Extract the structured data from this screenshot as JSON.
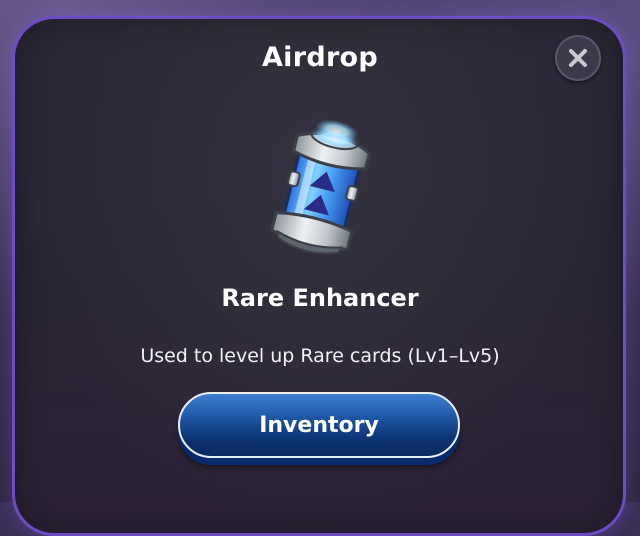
{
  "modal": {
    "title": "Airdrop",
    "close_icon": "close-icon"
  },
  "item": {
    "icon": "rare-enhancer-canister-icon",
    "name": "Rare Enhancer",
    "description": "Used to level up Rare cards (Lv1–Lv5)"
  },
  "actions": {
    "inventory_label": "Inventory"
  },
  "colors": {
    "modal_border": "#6d4cc4",
    "button_blue": "#1f5aa8",
    "canister_glow": "#5fb8ff"
  }
}
